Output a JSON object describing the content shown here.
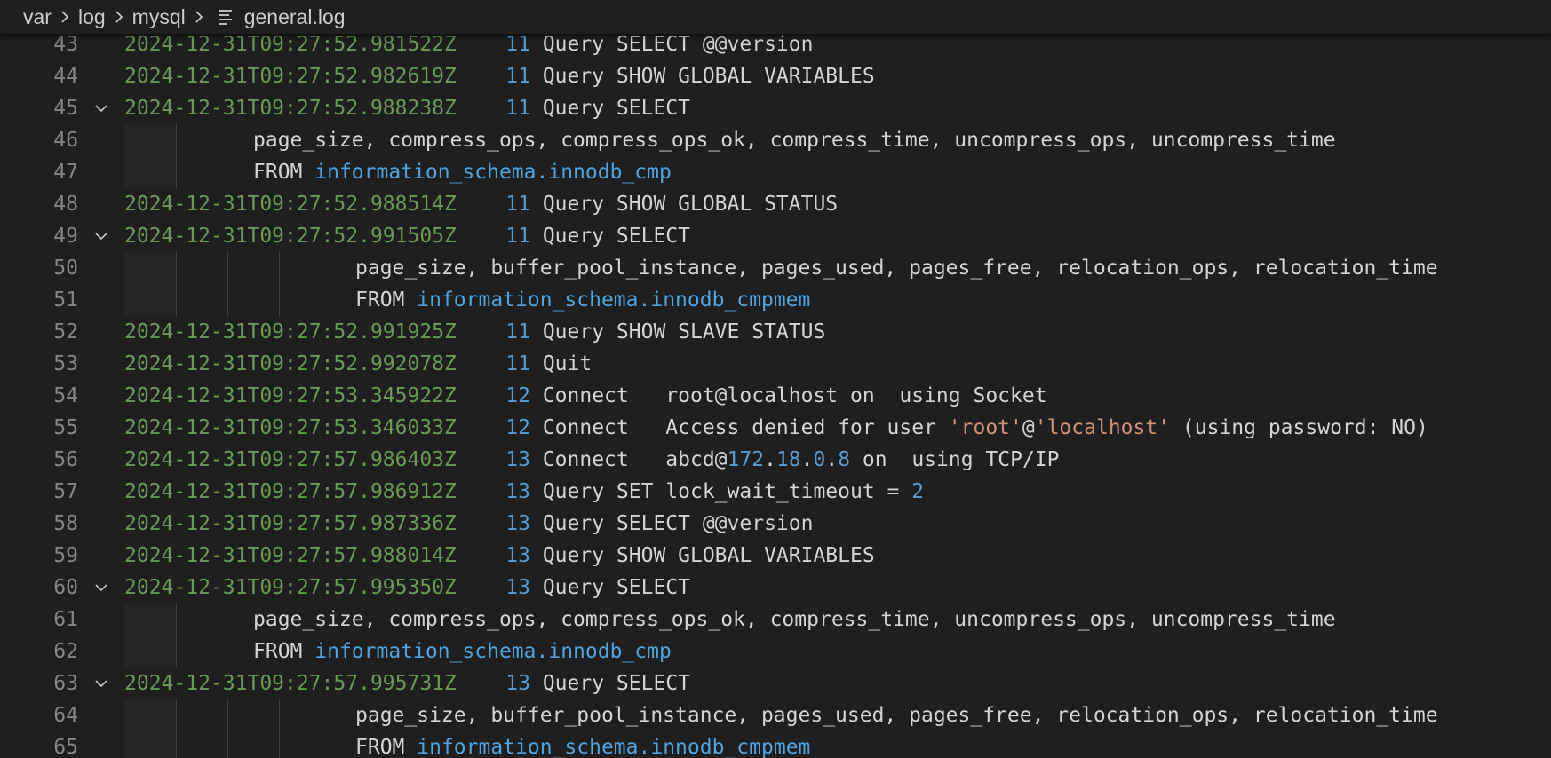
{
  "breadcrumb": {
    "items": [
      "var",
      "log",
      "mysql"
    ],
    "file_icon": "file-lines-icon",
    "file": "general.log"
  },
  "colors": {
    "background": "#1f1f1f",
    "timestamp": "#6a9955",
    "number": "#569cd6",
    "string": "#ce9178",
    "line_number": "#858585"
  },
  "lines": [
    {
      "n": "43",
      "fold": false,
      "ts": "2024-12-31T09:27:52.981522Z",
      "id": "11",
      "rest": " Query SELECT @@version"
    },
    {
      "n": "44",
      "fold": false,
      "ts": "2024-12-31T09:27:52.982619Z",
      "id": "11",
      "rest": " Query SHOW GLOBAL VARIABLES"
    },
    {
      "n": "45",
      "fold": true,
      "ts": "2024-12-31T09:27:52.988238Z",
      "id": "11",
      "rest": " Query SELECT"
    },
    {
      "n": "46",
      "fold": false,
      "level": 1,
      "text": "page_size, compress_ops, compress_ops_ok, compress_time, uncompress_ops, uncompress_time"
    },
    {
      "n": "47",
      "fold": false,
      "level": 1,
      "kw": "FROM ",
      "link": "information_schema.innodb_cmp"
    },
    {
      "n": "48",
      "fold": false,
      "ts": "2024-12-31T09:27:52.988514Z",
      "id": "11",
      "rest": " Query SHOW GLOBAL STATUS"
    },
    {
      "n": "49",
      "fold": true,
      "ts": "2024-12-31T09:27:52.991505Z",
      "id": "11",
      "rest": " Query SELECT"
    },
    {
      "n": "50",
      "fold": false,
      "level": 2,
      "text": "page_size, buffer_pool_instance, pages_used, pages_free, relocation_ops, relocation_time"
    },
    {
      "n": "51",
      "fold": false,
      "level": 2,
      "kw": "FROM ",
      "link": "information_schema.innodb_cmpmem"
    },
    {
      "n": "52",
      "fold": false,
      "ts": "2024-12-31T09:27:52.991925Z",
      "id": "11",
      "rest": " Query SHOW SLAVE STATUS"
    },
    {
      "n": "53",
      "fold": false,
      "ts": "2024-12-31T09:27:52.992078Z",
      "id": "11",
      "rest": " Quit"
    },
    {
      "n": "54",
      "fold": false,
      "ts": "2024-12-31T09:27:53.345922Z",
      "id": "12",
      "rest": " Connect   root@localhost on  using Socket"
    },
    {
      "n": "55",
      "fold": false,
      "ts": "2024-12-31T09:27:53.346033Z",
      "id": "12",
      "rest": " Connect   Access denied for user ",
      "str1": "'root'",
      "mid": "@",
      "str2": "'localhost'",
      "tail": " (using password: NO)"
    },
    {
      "n": "56",
      "fold": false,
      "ts": "2024-12-31T09:27:57.986403Z",
      "id": "13",
      "rest": " Connect   abcd@",
      "ip": [
        "172",
        "18",
        "0",
        "8"
      ],
      "tail": " on  using TCP/IP"
    },
    {
      "n": "57",
      "fold": false,
      "ts": "2024-12-31T09:27:57.986912Z",
      "id": "13",
      "rest": " Query SET lock_wait_timeout = ",
      "endnum": "2"
    },
    {
      "n": "58",
      "fold": false,
      "ts": "2024-12-31T09:27:57.987336Z",
      "id": "13",
      "rest": " Query SELECT @@version"
    },
    {
      "n": "59",
      "fold": false,
      "ts": "2024-12-31T09:27:57.988014Z",
      "id": "13",
      "rest": " Query SHOW GLOBAL VARIABLES"
    },
    {
      "n": "60",
      "fold": true,
      "ts": "2024-12-31T09:27:57.995350Z",
      "id": "13",
      "rest": " Query SELECT"
    },
    {
      "n": "61",
      "fold": false,
      "level": 1,
      "text": "page_size, compress_ops, compress_ops_ok, compress_time, uncompress_ops, uncompress_time"
    },
    {
      "n": "62",
      "fold": false,
      "level": 1,
      "kw": "FROM ",
      "link": "information_schema.innodb_cmp"
    },
    {
      "n": "63",
      "fold": true,
      "ts": "2024-12-31T09:27:57.995731Z",
      "id": "13",
      "rest": " Query SELECT"
    },
    {
      "n": "64",
      "fold": false,
      "level": 2,
      "text": "page_size, buffer_pool_instance, pages_used, pages_free, relocation_ops, relocation_time"
    },
    {
      "n": "65",
      "fold": false,
      "level": 2,
      "kw": "FROM ",
      "link": "information_schema.innodb_cmpmem"
    }
  ]
}
